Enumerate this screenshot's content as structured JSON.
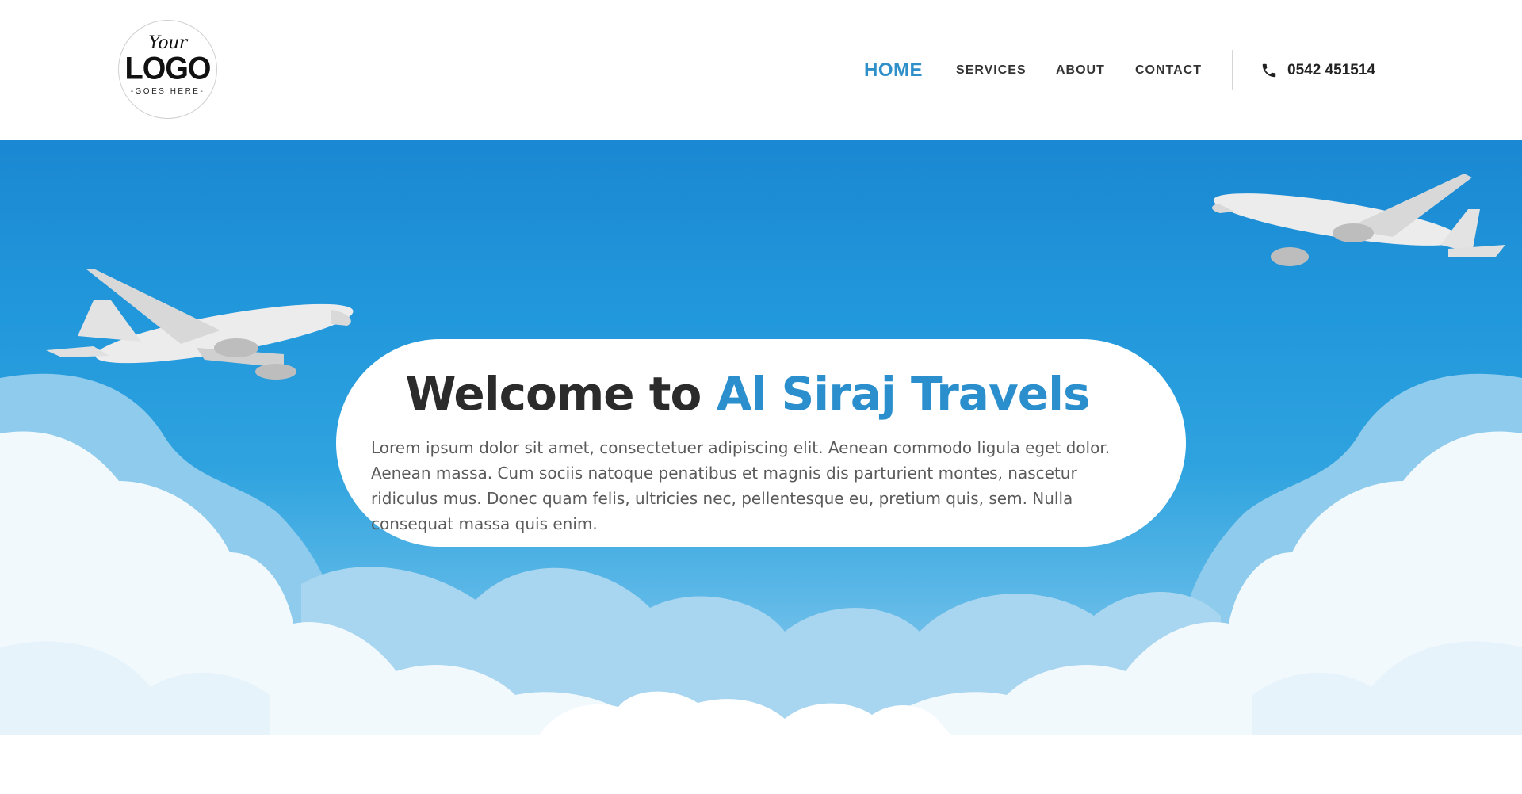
{
  "header": {
    "logo": {
      "line1": "Your",
      "line2": "LOGO",
      "line3": "-GOES HERE-"
    },
    "nav": [
      {
        "label": "HOME",
        "active": true
      },
      {
        "label": "SERVICES",
        "active": false
      },
      {
        "label": "ABOUT",
        "active": false
      },
      {
        "label": "CONTACT",
        "active": false
      }
    ],
    "phone": {
      "icon": "phone-icon",
      "number": "0542 451514"
    }
  },
  "hero": {
    "title_prefix": "Welcome to",
    "title_accent": "Al Siraj Travels",
    "text": "Lorem ipsum dolor sit amet, consectetuer adipiscing elit. Aenean commodo ligula eget dolor. Aenean massa. Cum sociis natoque penatibus et magnis dis parturient montes, nascetur ridiculus mus. Donec quam felis, ultricies nec, pellentesque eu, pretium quis, sem. Nulla consequat massa quis enim.",
    "illustrations": [
      "airplane-left",
      "airplane-right",
      "clouds"
    ]
  },
  "colors": {
    "accent": "#2a8fcc",
    "sky_top": "#1a88d2",
    "sky_bottom": "#9bd0ef",
    "text_dark": "#2b2b2b"
  }
}
